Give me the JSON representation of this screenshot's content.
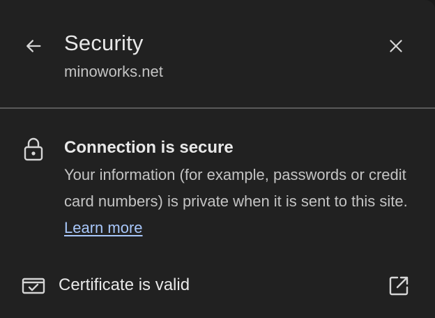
{
  "header": {
    "title": "Security",
    "subtitle": "minoworks.net",
    "back_icon": "arrow-back-icon",
    "close_icon": "close-icon"
  },
  "connection": {
    "icon": "lock-icon",
    "title": "Connection is secure",
    "description": "Your information (for example, passwords or credit card numbers) is private when it is sent to this site.",
    "link_label": "Learn more"
  },
  "certificate": {
    "icon": "certificate-check-icon",
    "label": "Certificate is valid",
    "external_icon": "open-in-new-icon"
  },
  "colors": {
    "background": "#212121",
    "text_primary": "#e8e8e8",
    "text_secondary": "#c4c4c4",
    "link": "#a8c7fa",
    "divider": "#5a5a5a"
  }
}
